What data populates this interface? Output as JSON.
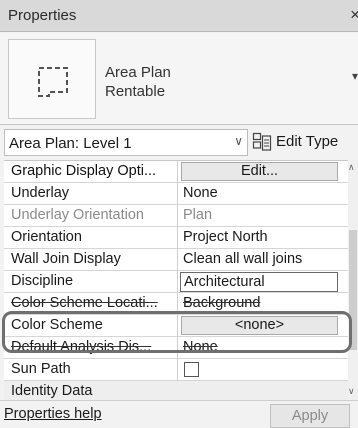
{
  "window": {
    "title": "Properties",
    "close_glyph": "×"
  },
  "type_selector": {
    "line1": "Area Plan",
    "line2": "Rentable",
    "icon": "area-plan-icon"
  },
  "instance": {
    "selected": "Area Plan: Level 1",
    "edit_type_label": "Edit Type"
  },
  "properties": [
    {
      "name": "Graphic Display Opti...",
      "value": "Edit...",
      "kind": "button"
    },
    {
      "name": "Underlay",
      "value": "None",
      "kind": "text"
    },
    {
      "name": "Underlay Orientation",
      "value": "Plan",
      "kind": "dim"
    },
    {
      "name": "Orientation",
      "value": "Project North",
      "kind": "text"
    },
    {
      "name": "Wall Join Display",
      "value": "Clean all wall joins",
      "kind": "text"
    },
    {
      "name": "Discipline",
      "value": "Architectural",
      "kind": "input"
    },
    {
      "name": "Color Scheme Locati...",
      "value": "Background",
      "kind": "strike"
    },
    {
      "name": "Color Scheme",
      "value": "<none>",
      "kind": "button"
    },
    {
      "name": "Default Analysis Dis...",
      "value": "None",
      "kind": "strike"
    },
    {
      "name": "Sun Path",
      "value": "",
      "kind": "checkbox"
    },
    {
      "name": "Identity Data",
      "value": "",
      "kind": "group"
    }
  ],
  "footer": {
    "help_link": "Properties help",
    "apply_label": "Apply"
  }
}
